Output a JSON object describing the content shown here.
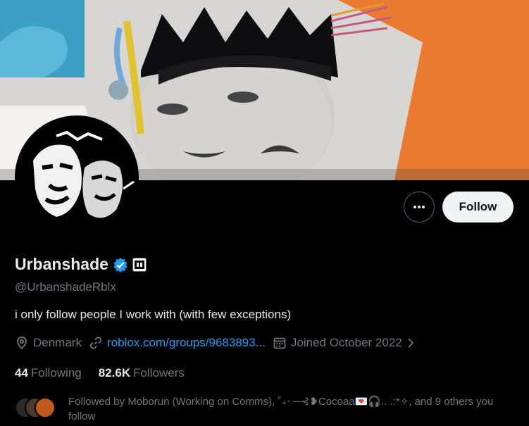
{
  "profile": {
    "display_name": "Urbanshade",
    "handle": "@UrbanshadeRblx",
    "bio": "i only follow people I work with (with few exceptions)",
    "location": "Denmark",
    "link": "roblox.com/groups/9683893...",
    "joined": "Joined October 2022"
  },
  "buttons": {
    "follow": "Follow"
  },
  "stats": {
    "following_count": "44",
    "following_label": "Following",
    "followers_count": "82.6K",
    "followers_label": "Followers"
  },
  "followed_by": {
    "text": "Followed by Moborun (Working on Comms), ˚₊‧ ─⊰❥Cocoaa💌🎧.. .:*✧, and 9 others you follow"
  },
  "icons": [
    "verified-badge-icon",
    "affiliate-badge-icon",
    "more-icon",
    "location-icon",
    "link-icon",
    "calendar-icon",
    "chevron-right-icon"
  ],
  "colors": {
    "background": "#000000",
    "text_primary": "#e7e9ea",
    "text_secondary": "#71767b",
    "accent": "#1d9bf0",
    "follow_button_bg": "#eff3f4"
  }
}
